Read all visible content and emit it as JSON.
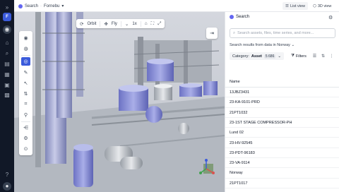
{
  "breadcrumb": {
    "section": "Search",
    "location": "Fornebu"
  },
  "view_toggle": {
    "list_label": "List view",
    "threed_label": "3D view"
  },
  "viewer_toolbar": {
    "orbit_label": "Orbit",
    "fly_label": "Fly",
    "speed_label": "1x"
  },
  "panel": {
    "title": "Search",
    "search_placeholder": "Search assets, files, time series, and more...",
    "scope_label": "Search results from data in Norway",
    "category_label": "Category:",
    "category_value": "Asset",
    "category_count": "5 686",
    "filters_label": "Filters",
    "column_header": "Name",
    "results": [
      "13JBZ3431",
      "23-KA-9101-PRD",
      "21PT1032",
      "23-1ST STAGE COMPRESSOR-PH",
      "Lund 02",
      "23-HV-92545",
      "23-PDT-96183",
      "23-VA-9114",
      "Norway",
      "21PT1017"
    ]
  },
  "colors": {
    "accent": "#3b5bdb",
    "rail_bg": "#111827",
    "tank_blue": "#8f95d6"
  }
}
